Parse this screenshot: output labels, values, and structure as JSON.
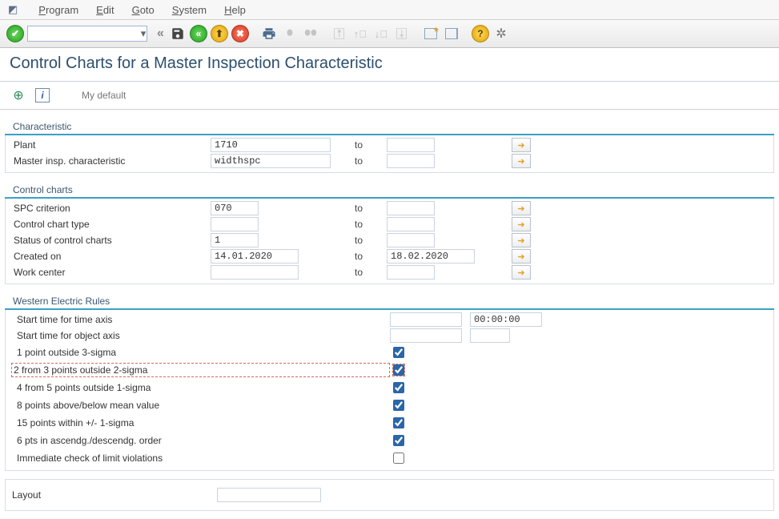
{
  "menu": {
    "program": "Program",
    "edit": "Edit",
    "goto": "Goto",
    "system": "System",
    "help": "Help"
  },
  "page": {
    "title": "Control Charts for a Master Inspection Characteristic",
    "my_default": "My default"
  },
  "characteristic": {
    "header": "Characteristic",
    "plant_label": "Plant",
    "plant_from": "1710",
    "plant_to": "",
    "mic_label": "Master insp. characteristic",
    "mic_from": "widthspc",
    "mic_to": "",
    "to": "to"
  },
  "control_charts": {
    "header": "Control charts",
    "spc_label": "SPC criterion",
    "spc_from": "070",
    "spc_to": "",
    "type_label": "Control chart type",
    "type_from": "",
    "type_to": "",
    "status_label": "Status of control charts",
    "status_from": "1",
    "status_to": "",
    "created_label": "Created on",
    "created_from": "14.01.2020",
    "created_to": "18.02.2020",
    "workcenter_label": "Work center",
    "workcenter_from": "",
    "workcenter_to": "",
    "to": "to"
  },
  "western": {
    "header": "Western Electric Rules",
    "start_time_label": "Start time for time axis",
    "start_time_date": "",
    "start_time_time": "00:00:00",
    "start_object_label": "Start time for object axis",
    "start_object_from": "",
    "start_object_to": "",
    "r1": "1 point outside 3-sigma",
    "r2": "2 from 3 points outside 2-sigma",
    "r3": "4 from 5 points outside 1-sigma",
    "r4": "8 points above/below mean value",
    "r5": "15 points within +/- 1-sigma",
    "r6": "6 pts in ascendg./descendg. order",
    "r7": "Immediate check of limit violations"
  },
  "layout": {
    "label": "Layout",
    "value": ""
  },
  "icons": {
    "arrow": "➜"
  }
}
